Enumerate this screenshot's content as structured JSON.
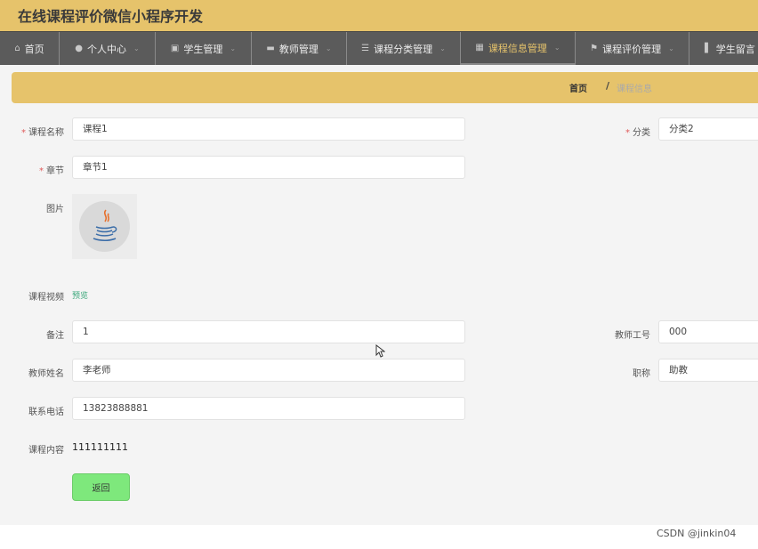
{
  "app": {
    "title": "在线课程评价微信小程序开发"
  },
  "nav": {
    "items": [
      {
        "label": "首页",
        "icon": "home-icon",
        "has_dropdown": false
      },
      {
        "label": "个人中心",
        "icon": "user-icon",
        "has_dropdown": true
      },
      {
        "label": "学生管理",
        "icon": "clipboard-icon",
        "has_dropdown": true
      },
      {
        "label": "教师管理",
        "icon": "monitor-icon",
        "has_dropdown": true
      },
      {
        "label": "课程分类管理",
        "icon": "list-icon",
        "has_dropdown": true
      },
      {
        "label": "课程信息管理",
        "icon": "grid-icon",
        "has_dropdown": true,
        "active": true
      },
      {
        "label": "课程评价管理",
        "icon": "flag-icon",
        "has_dropdown": true
      },
      {
        "label": "学生留言",
        "icon": "chart-icon",
        "has_dropdown": false
      }
    ]
  },
  "breadcrumb": {
    "home": "首页",
    "separator": "/",
    "current": "课程信息"
  },
  "form": {
    "course_name": {
      "label": "课程名称",
      "value": "课程1",
      "required": true
    },
    "category": {
      "label": "分类",
      "value": "分类2",
      "required": true
    },
    "chapter": {
      "label": "章节",
      "value": "章节1",
      "required": true
    },
    "image": {
      "label": "图片",
      "icon": "java-logo-icon"
    },
    "video": {
      "label": "课程视频",
      "link": "预览"
    },
    "remark": {
      "label": "备注",
      "value": "1"
    },
    "teacher_id": {
      "label": "教师工号",
      "value": "000"
    },
    "teacher_name": {
      "label": "教师姓名",
      "value": "李老师"
    },
    "title": {
      "label": "职称",
      "value": "助教"
    },
    "phone": {
      "label": "联系电话",
      "value": "13823888881"
    },
    "content": {
      "label": "课程内容",
      "value": "111111111"
    },
    "back_button": "返回"
  },
  "watermark": "CSDN @jinkin04",
  "colors": {
    "accent": "#e6c36b",
    "nav_bg": "#5b5b5b",
    "button_green": "#7ee87c",
    "link_green": "#3aa77a",
    "required_red": "#e05a5a"
  }
}
